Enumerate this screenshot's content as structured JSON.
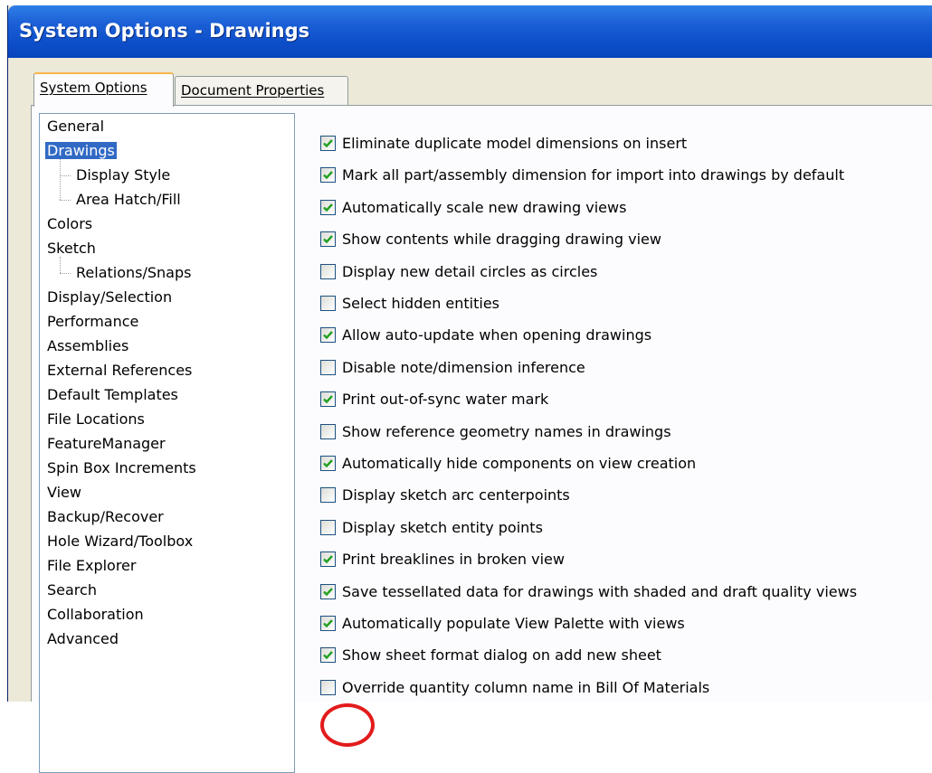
{
  "window": {
    "title": "System Options - Drawings"
  },
  "tabs": [
    {
      "label": "System Options",
      "active": true
    },
    {
      "label": "Document Properties",
      "active": false
    }
  ],
  "tree": {
    "items": [
      {
        "label": "General",
        "level": 0
      },
      {
        "label": "Drawings",
        "level": 0,
        "selected": true
      },
      {
        "label": "Display Style",
        "level": 1
      },
      {
        "label": "Area Hatch/Fill",
        "level": 1
      },
      {
        "label": "Colors",
        "level": 0
      },
      {
        "label": "Sketch",
        "level": 0
      },
      {
        "label": "Relations/Snaps",
        "level": 1
      },
      {
        "label": "Display/Selection",
        "level": 0
      },
      {
        "label": "Performance",
        "level": 0
      },
      {
        "label": "Assemblies",
        "level": 0
      },
      {
        "label": "External References",
        "level": 0
      },
      {
        "label": "Default Templates",
        "level": 0
      },
      {
        "label": "File Locations",
        "level": 0
      },
      {
        "label": "FeatureManager",
        "level": 0
      },
      {
        "label": "Spin Box Increments",
        "level": 0
      },
      {
        "label": "View",
        "level": 0
      },
      {
        "label": "Backup/Recover",
        "level": 0
      },
      {
        "label": "Hole Wizard/Toolbox",
        "level": 0
      },
      {
        "label": "File Explorer",
        "level": 0
      },
      {
        "label": "Search",
        "level": 0
      },
      {
        "label": "Collaboration",
        "level": 0
      },
      {
        "label": "Advanced",
        "level": 0
      }
    ]
  },
  "options": [
    {
      "label": "Eliminate duplicate model dimensions on insert",
      "checked": true
    },
    {
      "label": "Mark all part/assembly dimension for import into drawings by default",
      "checked": true
    },
    {
      "label": "Automatically scale new drawing views",
      "checked": true
    },
    {
      "label": "Show contents while dragging drawing view",
      "checked": true
    },
    {
      "label": "Display new detail circles as circles",
      "checked": false
    },
    {
      "label": "Select hidden entities",
      "checked": false
    },
    {
      "label": "Allow auto-update when opening drawings",
      "checked": true
    },
    {
      "label": "Disable note/dimension inference",
      "checked": false
    },
    {
      "label": "Print out-of-sync water mark",
      "checked": true
    },
    {
      "label": "Show reference geometry names in drawings",
      "checked": false
    },
    {
      "label": "Automatically hide components on view creation",
      "checked": true
    },
    {
      "label": "Display sketch arc centerpoints",
      "checked": false
    },
    {
      "label": "Display sketch entity points",
      "checked": false
    },
    {
      "label": "Print breaklines in broken view",
      "checked": true
    },
    {
      "label": "Save tessellated data for drawings with shaded and draft quality views",
      "checked": true
    },
    {
      "label": "Automatically populate View Palette with views",
      "checked": true
    },
    {
      "label": "Show sheet format dialog on add new sheet",
      "checked": true
    },
    {
      "label": "Override quantity column name in Bill Of Materials",
      "checked": false
    }
  ],
  "colors": {
    "titlebar": "#0d4fc9",
    "selection": "#316ac5",
    "checkmark": "#21a121",
    "highlight_circle": "#e21b1b"
  }
}
